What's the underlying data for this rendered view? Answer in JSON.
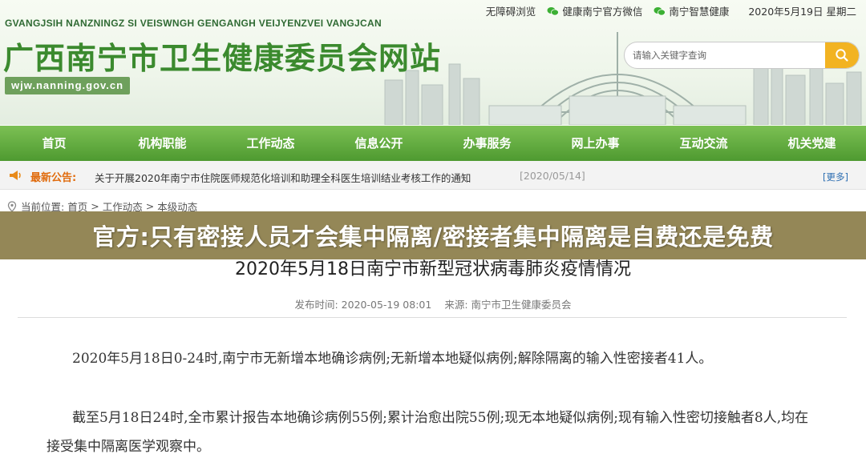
{
  "header": {
    "site_en": "GVANGJSIH NANZNINGZ SI VEISWNGH GENGANGH VEIJYENZVEI VANGJCAN",
    "site_cn": "广西南宁市卫生健康委员会网站",
    "site_url": "wjw.nanning.gov.cn",
    "top_links": {
      "accessible": "无障碍浏览",
      "wechat_official": "健康南宁官方微信",
      "smart_health": "南宁智慧健康",
      "date": "2020年5月19日 星期二"
    },
    "search": {
      "placeholder": "请输入关键字查询"
    }
  },
  "nav": {
    "items": [
      "首页",
      "机构职能",
      "工作动态",
      "信息公开",
      "办事服务",
      "网上办事",
      "互动交流",
      "机关党建"
    ]
  },
  "notice": {
    "label": "最新公告:",
    "text": "关于开展2020年南宁市住院医师规范化培训和助理全科医生培训结业考核工作的通知",
    "date": "[2020/05/14]",
    "more": "[更多]"
  },
  "breadcrumb": {
    "label": "当前位置:",
    "items": [
      "首页",
      "工作动态",
      "本级动态"
    ],
    "sep": ">"
  },
  "banner": {
    "text": "官方:只有密接人员才会集中隔离/密接者集中隔离是自费还是免费"
  },
  "article": {
    "title": "2020年5月18日南宁市新型冠状病毒肺炎疫情情况",
    "publish_time": "发布时间:  2020-05-19 08:01",
    "source": "来源:  南宁市卫生健康委员会",
    "para1": "2020年5月18日0-24时,南宁市无新增本地确诊病例;无新增本地疑似病例;解除隔离的输入性密接者41人。",
    "para2": "截至5月18日24时,全市累计报告本地确诊病例55例;累计治愈出院55例;现无本地疑似病例;现有输入性密切接触者8人,均在接受集中隔离医学观察中。"
  },
  "colors": {
    "nav_green": "#4e9a30",
    "title_green": "#3b8a2e",
    "search_button": "#f2b322",
    "notice_label": "#e06b0d",
    "banner_bg": "#8c7e4a"
  }
}
